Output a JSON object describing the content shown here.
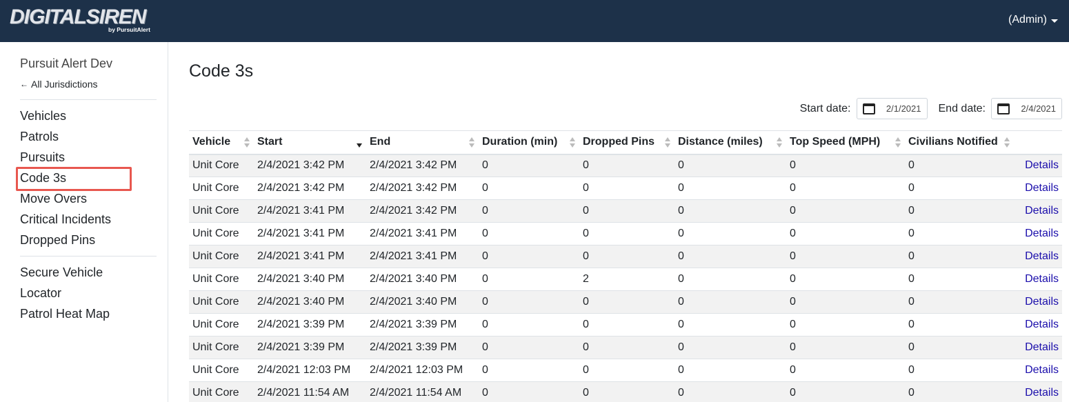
{
  "brand": {
    "name": "DIGITALSIREN",
    "tagline": "by PursuitAlert"
  },
  "user_menu": {
    "label": "(Admin)"
  },
  "sidebar": {
    "jurisdiction": "Pursuit Alert Dev",
    "back_link": "All Jurisdictions",
    "groups": [
      [
        "Vehicles",
        "Patrols",
        "Pursuits",
        "Code 3s",
        "Move Overs",
        "Critical Incidents",
        "Dropped Pins"
      ],
      [
        "Secure Vehicle",
        "Locator",
        "Patrol Heat Map"
      ]
    ],
    "active_item": "Code 3s"
  },
  "page": {
    "title": "Code 3s"
  },
  "filters": {
    "start_label": "Start date:",
    "start_value": "2/1/2021",
    "end_label": "End date:",
    "end_value": "2/4/2021"
  },
  "table": {
    "columns": [
      "Vehicle",
      "Start",
      "End",
      "Duration (min)",
      "Dropped Pins",
      "Distance (miles)",
      "Top Speed (MPH)",
      "Civilians Notified"
    ],
    "sorted_column": "Start",
    "sort_direction": "descending",
    "action_label": "Details",
    "rows": [
      [
        "Unit Core",
        "2/4/2021 3:42 PM",
        "2/4/2021 3:42 PM",
        "0",
        "0",
        "0",
        "0",
        "0"
      ],
      [
        "Unit Core",
        "2/4/2021 3:42 PM",
        "2/4/2021 3:42 PM",
        "0",
        "0",
        "0",
        "0",
        "0"
      ],
      [
        "Unit Core",
        "2/4/2021 3:41 PM",
        "2/4/2021 3:42 PM",
        "0",
        "0",
        "0",
        "0",
        "0"
      ],
      [
        "Unit Core",
        "2/4/2021 3:41 PM",
        "2/4/2021 3:41 PM",
        "0",
        "0",
        "0",
        "0",
        "0"
      ],
      [
        "Unit Core",
        "2/4/2021 3:41 PM",
        "2/4/2021 3:41 PM",
        "0",
        "0",
        "0",
        "0",
        "0"
      ],
      [
        "Unit Core",
        "2/4/2021 3:40 PM",
        "2/4/2021 3:40 PM",
        "0",
        "2",
        "0",
        "0",
        "0"
      ],
      [
        "Unit Core",
        "2/4/2021 3:40 PM",
        "2/4/2021 3:40 PM",
        "0",
        "0",
        "0",
        "0",
        "0"
      ],
      [
        "Unit Core",
        "2/4/2021 3:39 PM",
        "2/4/2021 3:39 PM",
        "0",
        "0",
        "0",
        "0",
        "0"
      ],
      [
        "Unit Core",
        "2/4/2021 3:39 PM",
        "2/4/2021 3:39 PM",
        "0",
        "0",
        "0",
        "0",
        "0"
      ],
      [
        "Unit Core",
        "2/4/2021 12:03 PM",
        "2/4/2021 12:03 PM",
        "0",
        "0",
        "0",
        "0",
        "0"
      ],
      [
        "Unit Core",
        "2/4/2021 11:54 AM",
        "2/4/2021 11:54 AM",
        "0",
        "0",
        "0",
        "0",
        "0"
      ]
    ]
  },
  "colors": {
    "navbar": "#1d3149",
    "link": "#1a0dab",
    "highlight": "#e8574f",
    "stripe": "#f2f2f2"
  }
}
